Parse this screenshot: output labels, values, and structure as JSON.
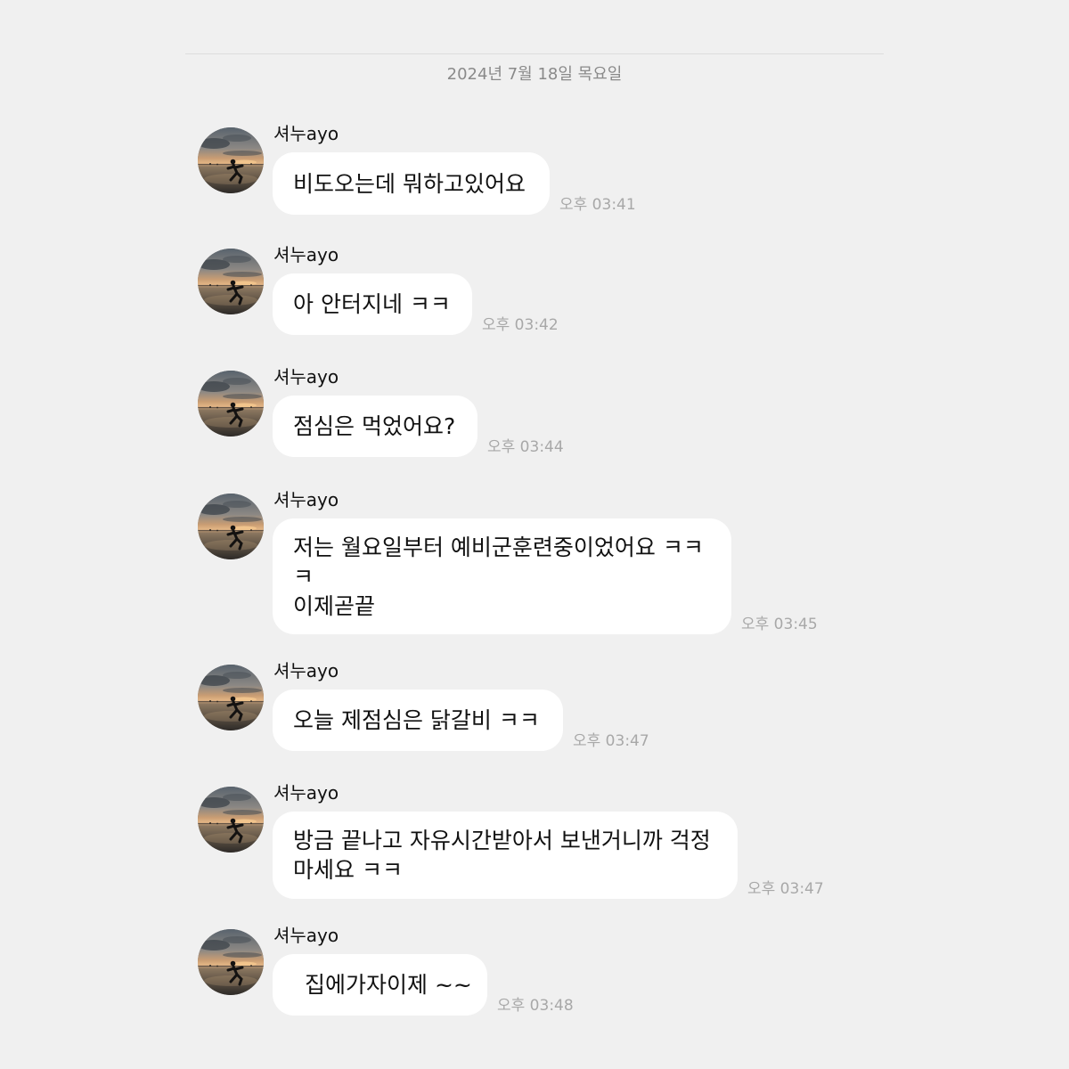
{
  "date_separator": "2024년 7월 18일 목요일",
  "avatar_image": "profile-photo-sunset-silhouette",
  "colors": {
    "background": "#f0f0f0",
    "bubble": "#ffffff",
    "text": "#111111",
    "timestamp": "#a8a8a8",
    "date": "#8a8a8a"
  },
  "messages": [
    {
      "sender": "셔누ayo",
      "text": "비도오는데 뭐하고있어요",
      "time": "오후 03:41"
    },
    {
      "sender": "셔누ayo",
      "text": "아 안터지네 ㅋㅋ",
      "time": "오후 03:42"
    },
    {
      "sender": "셔누ayo",
      "text": "점심은 먹었어요?",
      "time": "오후 03:44"
    },
    {
      "sender": "셔누ayo",
      "text": "저는 월요일부터 예비군훈련중이었어요 ㅋㅋ\nㅋ\n이제곧끝",
      "time": "오후 03:45"
    },
    {
      "sender": "셔누ayo",
      "text": "오늘 제점심은 닭갈비 ㅋㅋ",
      "time": "오후 03:47"
    },
    {
      "sender": "셔누ayo",
      "text": "방금 끝나고 자유시간받아서 보낸거니까 걱정\n마세요 ㅋㅋ",
      "time": "오후 03:47"
    },
    {
      "sender": "셔누ayo",
      "text": "집에가자이제 ~~",
      "time": "오후 03:48"
    }
  ]
}
